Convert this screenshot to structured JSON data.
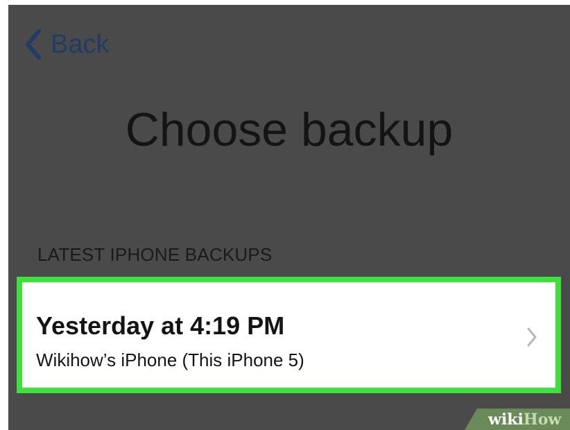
{
  "nav": {
    "back_label": "Back",
    "back_icon": "chevron-left-icon"
  },
  "page": {
    "title": "Choose backup"
  },
  "section": {
    "header": "LATEST IPHONE BACKUPS"
  },
  "backup_item": {
    "title": "Yesterday at 4:19 PM",
    "subtitle": "Wikihow’s iPhone (This iPhone 5)",
    "disclosure_icon": "chevron-right-icon",
    "highlight_color": "#3ee03a"
  },
  "watermark": {
    "part1": "wiki",
    "part2": "How"
  },
  "colors": {
    "background_dimmed": "#4a4a4a",
    "back_accent": "#213c66",
    "row_background": "#ffffff"
  }
}
